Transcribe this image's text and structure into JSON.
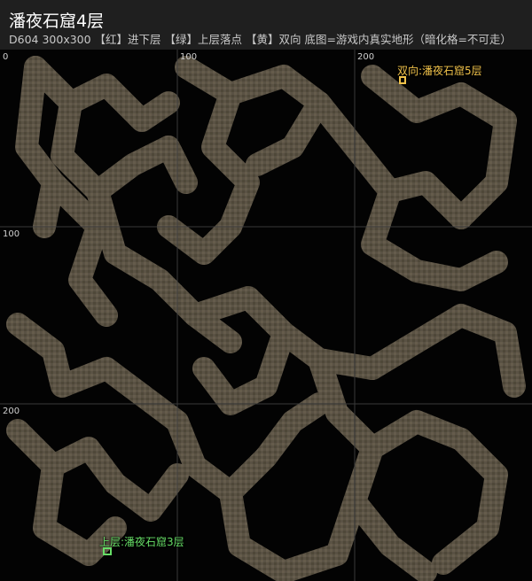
{
  "header": {
    "title": "潘夜石窟4层",
    "subtitle": "D604  300x300  【红】进下层  【绿】上层落点  【黄】双向  底图=游戏内真实地形（暗化格=不可走）"
  },
  "axis": {
    "x_labels": [
      "0",
      "100",
      "200"
    ],
    "y_labels": [
      "100",
      "200"
    ]
  },
  "markers": [
    {
      "label": "双向:潘夜石窟5层",
      "color": "#f0c24a",
      "kind": "yellow"
    },
    {
      "label": "上层:潘夜石窟3层",
      "color": "#66dd66",
      "kind": "green"
    }
  ],
  "colors": {
    "floor": "#5e5648",
    "floor_edge": "#8a806c",
    "void": "#030303"
  }
}
